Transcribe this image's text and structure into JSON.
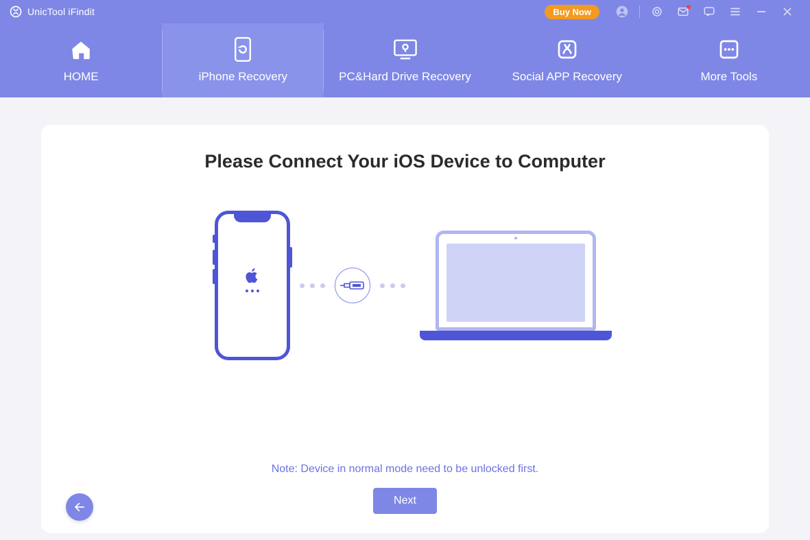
{
  "titlebar": {
    "app_name": "UnicTool iFindit",
    "buy_label": "Buy Now"
  },
  "nav": {
    "tabs": [
      {
        "label": "HOME"
      },
      {
        "label": "iPhone Recovery"
      },
      {
        "label": "PC&Hard Drive Recovery"
      },
      {
        "label": "Social APP Recovery"
      },
      {
        "label": "More Tools"
      }
    ],
    "active_index": 1
  },
  "main": {
    "heading": "Please Connect Your iOS Device to Computer",
    "note": "Note: Device in normal mode need to be unlocked first.",
    "next_label": "Next"
  },
  "colors": {
    "primary": "#7e87e6",
    "primary_dark": "#4f55d7",
    "accent": "#f39a1f"
  }
}
